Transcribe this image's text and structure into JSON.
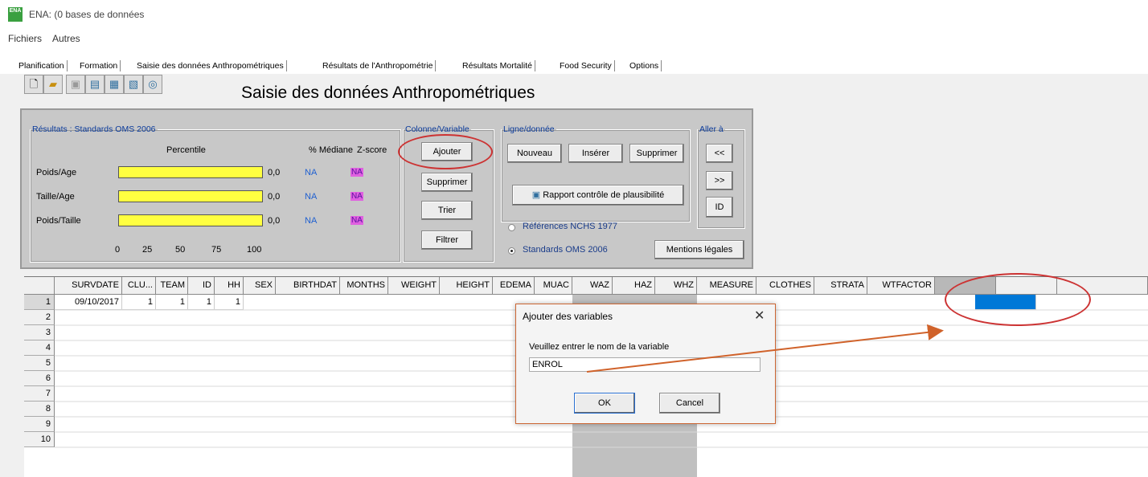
{
  "window": {
    "title": "ENA:  (0 bases de données",
    "icon_text": "ENA"
  },
  "menu": [
    "Fichiers",
    "Autres"
  ],
  "tabs": [
    "Planification",
    "Formation",
    "Saisie des données Anthropométriques",
    "Résultats de l'Anthropométrie",
    "Résultats Mortalité",
    "Food Security",
    "Options"
  ],
  "active_tab": "Saisie des données Anthropométriques",
  "toolbar_icons": [
    "new-file-icon",
    "open-folder-icon",
    "save-icon",
    "database-icon",
    "export-icon",
    "import-icon",
    "search-icon"
  ],
  "page_title": "Saisie des données Anthropométriques",
  "results": {
    "legend": "Résultats : Standards OMS 2006",
    "col_percentile": "Percentile",
    "col_median": "% Médiane",
    "col_zscore": "Z-score",
    "rows": [
      {
        "label": "Poids/Age",
        "percentile": "0,0",
        "median": "NA",
        "zscore": "NA"
      },
      {
        "label": "Taille/Age",
        "percentile": "0,0",
        "median": "NA",
        "zscore": "NA"
      },
      {
        "label": "Poids/Taille",
        "percentile": "0,0",
        "median": "NA",
        "zscore": "NA"
      }
    ],
    "scale": [
      "0",
      "25",
      "50",
      "75",
      "100"
    ]
  },
  "colonne": {
    "legend": "Colonne/Variable",
    "buttons": [
      "Ajouter",
      "Supprimer",
      "Trier",
      "Filtrer"
    ]
  },
  "ligne": {
    "legend": "Ligne/donnée",
    "buttons": [
      "Nouveau",
      "Insérer",
      "Supprimer"
    ],
    "report_button": "Rapport contrôle de plausibilité",
    "radio_nchs": "Références NCHS 1977",
    "radio_oms": "Standards OMS 2006",
    "mentions": "Mentions légales"
  },
  "aller": {
    "legend": "Aller à",
    "buttons": [
      "<<",
      ">>",
      "ID"
    ]
  },
  "grid": {
    "columns": [
      "SURVDATE",
      "CLU...",
      "TEAM",
      "ID",
      "HH",
      "SEX",
      "BIRTHDAT",
      "MONTHS",
      "WEIGHT",
      "HEIGHT",
      "EDEMA",
      "MUAC",
      "WAZ",
      "HAZ",
      "WHZ",
      "MEASURE",
      "CLOTHES",
      "STRATA",
      "WTFACTOR",
      "",
      "",
      ""
    ],
    "row_numbers": [
      "1",
      "2",
      "3",
      "4",
      "5",
      "6",
      "7",
      "8",
      "9",
      "10"
    ],
    "row1": [
      "09/10/2017",
      "1",
      "1",
      "1",
      "1"
    ]
  },
  "dialog": {
    "title": "Ajouter des variables",
    "close": "✕",
    "prompt": "Veuillez entrer le nom de la variable",
    "input_value": "ENROL",
    "ok": "OK",
    "cancel": "Cancel"
  },
  "annotation_color": "#cc3333",
  "arrow_color": "#d0622a",
  "selection_color": "#0078d7"
}
